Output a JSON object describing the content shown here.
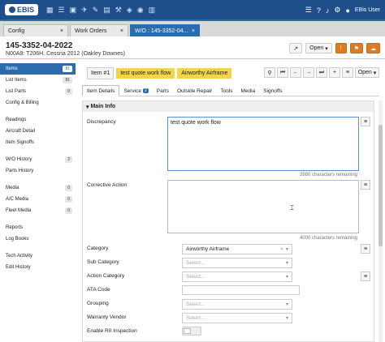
{
  "app": {
    "logo": "EBIS",
    "user": "EBis User"
  },
  "nav_icons": [
    "grid-icon",
    "layers-icon",
    "calendar-icon",
    "plane-icon",
    "wrench-icon",
    "clipboard-icon",
    "tools-icon",
    "shield-icon",
    "database-icon",
    "table-icon"
  ],
  "tabs": [
    {
      "label": "Config",
      "close": "×"
    },
    {
      "label": "Work Orders",
      "close": "×"
    },
    {
      "label": "W/O : 145-3352-04...",
      "close": "×"
    }
  ],
  "header": {
    "title": "145-3352-04-2022",
    "subtitle": "N00A9: T206H, Cessna 2012 (Oakley Downes)",
    "open_label": "Open"
  },
  "sidebar": {
    "items": [
      {
        "label": "Items",
        "badge": "81"
      },
      {
        "label": "List Items",
        "badge": "81"
      },
      {
        "label": "List Parts",
        "badge": "0"
      },
      {
        "label": "Config & Billing",
        "badge": ""
      },
      {
        "label": "Readings",
        "badge": ""
      },
      {
        "label": "Aircraft Detail",
        "badge": ""
      },
      {
        "label": "Item Signoffs",
        "badge": ""
      },
      {
        "label": "W/O History",
        "badge": "2"
      },
      {
        "label": "Parts History",
        "badge": ""
      },
      {
        "label": "Media",
        "badge": "0"
      },
      {
        "label": "A/C Media",
        "badge": "0"
      },
      {
        "label": "Fleet Media",
        "badge": "0"
      },
      {
        "label": "Reports",
        "badge": ""
      },
      {
        "label": "Log Books",
        "badge": ""
      },
      {
        "label": "Tech Activity",
        "badge": ""
      },
      {
        "label": "Edit History",
        "badge": ""
      }
    ]
  },
  "toolbar": {
    "item_num": "Item #1",
    "chip1": "test quote work flow",
    "chip2": "Airworthy Airframe",
    "open_label": "Open"
  },
  "subtabs": [
    {
      "label": "Item Details",
      "count": ""
    },
    {
      "label": "Service",
      "count": "2"
    },
    {
      "label": "Parts",
      "count": ""
    },
    {
      "label": "Outside Repair",
      "count": ""
    },
    {
      "label": "Tools",
      "count": ""
    },
    {
      "label": "Media",
      "count": ""
    },
    {
      "label": "Signoffs",
      "count": ""
    }
  ],
  "main_info": {
    "title": "Main Info",
    "discrepancy_label": "Discrepancy",
    "discrepancy_value": "test quote work flow",
    "discrepancy_remaining": "3980 characters remaining",
    "corrective_label": "Corrective Action",
    "corrective_value": "",
    "corrective_remaining": "4000 characters remaining",
    "category_label": "Category",
    "category_value": "Airworthy Airframe",
    "subcategory_label": "Sub Category",
    "action_category_label": "Action Category",
    "ata_label": "ATA Code",
    "grouping_label": "Grouping",
    "warranty_label": "Warranty Vendor",
    "rii_label": "Enable RII Inspection",
    "select_placeholder": "Select..."
  }
}
